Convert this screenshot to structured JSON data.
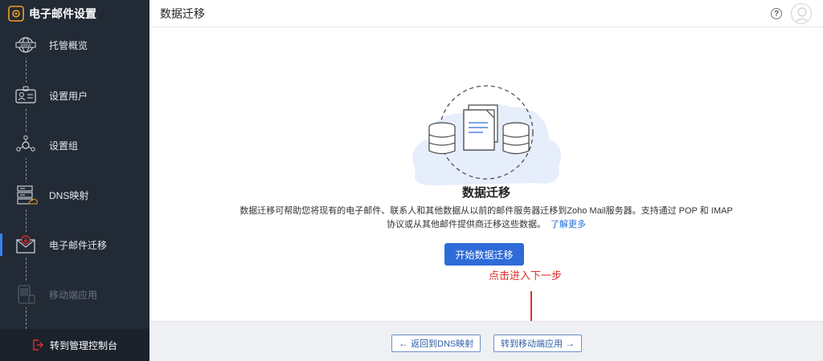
{
  "sidebar": {
    "title": "电子邮件设置",
    "items": [
      {
        "label": "托管概览",
        "icon": "www-globe-icon",
        "state": "default"
      },
      {
        "label": "设置用户",
        "icon": "user-card-icon",
        "state": "default"
      },
      {
        "label": "设置组",
        "icon": "group-icon",
        "state": "default"
      },
      {
        "label": "DNS映射",
        "icon": "dns-server-icon",
        "state": "default"
      },
      {
        "label": "电子邮件迁移",
        "icon": "mail-migration-icon",
        "state": "active"
      },
      {
        "label": "移动端应用",
        "icon": "mobile-app-icon",
        "state": "disabled"
      }
    ],
    "footer_label": "转到管理控制台"
  },
  "header": {
    "title": "数据迁移",
    "help_glyph": "?"
  },
  "main": {
    "section_title": "数据迁移",
    "description_line1": "数据迁移可帮助您将现有的电子邮件、联系人和其他数据从以前的邮件服务器迁移到Zoho Mail服务器。支持通过 POP 和 IMAP",
    "description_line2": "协议或从其他邮件提供商迁移这些数据。",
    "learn_more": "了解更多",
    "start_button": "开始数据迁移"
  },
  "annotation": {
    "text": "点击进入下一步",
    "color": "#e0302b"
  },
  "footer": {
    "prev_label": "返回到DNS映射",
    "next_label": "转到移动端应用",
    "prev_arrow": "←",
    "next_arrow": "→"
  },
  "colors": {
    "sidebar_bg": "#222a35",
    "accent": "#2f6bd8",
    "active_indicator": "#3b82f6"
  }
}
